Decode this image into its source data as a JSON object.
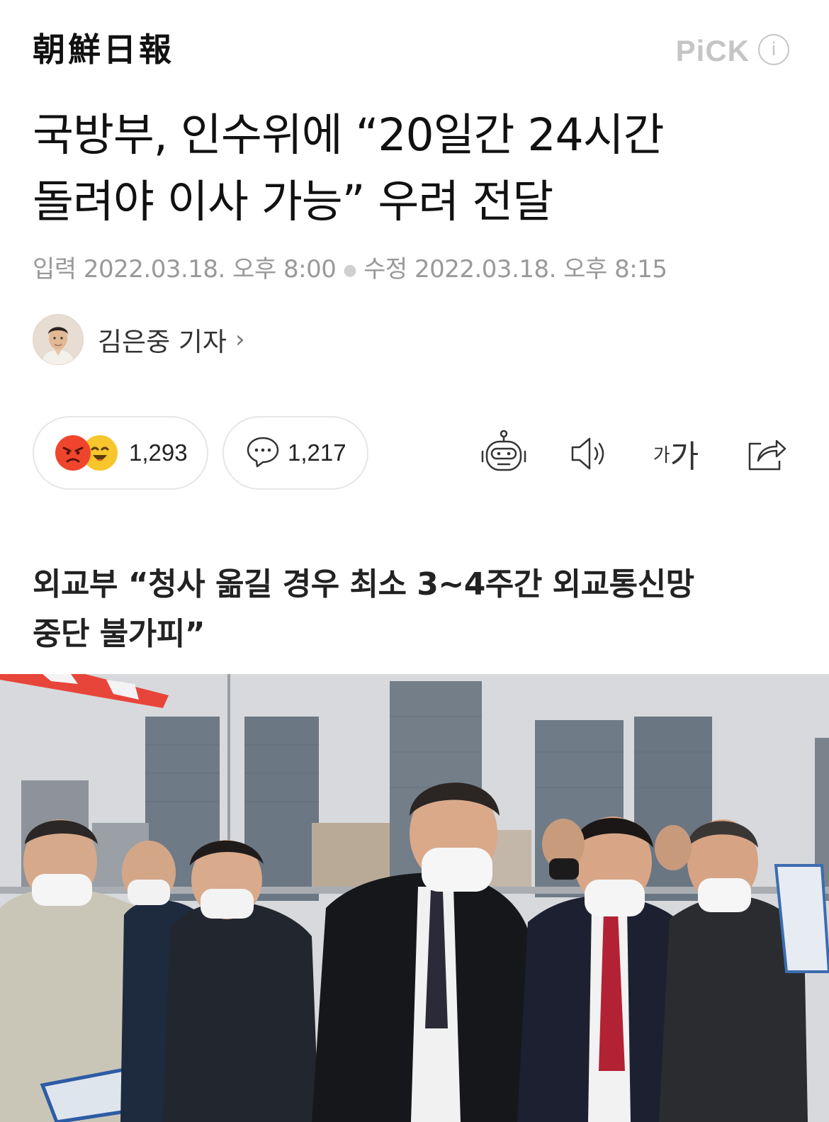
{
  "header": {
    "logo": "朝鮮日報",
    "pick_label": "PiCK",
    "info_icon_label": "i"
  },
  "article": {
    "title_line1": "국방부, 인수위에 “20일간 24시간",
    "title_line2": "돌려야 이사 가능” 우려 전달",
    "input_label": "입력",
    "input_datetime": "2022.03.18. 오후 8:00",
    "modified_label": "수정",
    "modified_datetime": "2022.03.18. 오후 8:15",
    "author": "김은중 기자",
    "subtitle_line1": "외교부 “청사 옮길 경우 최소 3~4주간 외교통신망",
    "subtitle_line2": "중단 불가피”"
  },
  "actions": {
    "reaction_count": "1,293",
    "comment_count": "1,217",
    "font_small": "가",
    "font_large": "가"
  },
  "icons": [
    "angry-emoji-icon",
    "laugh-emoji-icon",
    "comment-bubble-icon",
    "robot-summary-icon",
    "speaker-icon",
    "font-size-icon",
    "share-icon",
    "chevron-right-icon"
  ],
  "colors": {
    "reaction_angry": "#f0452d",
    "reaction_laugh": "#f7c52c",
    "meta_gray": "#999999",
    "pick_gray": "#c5c5c5"
  }
}
